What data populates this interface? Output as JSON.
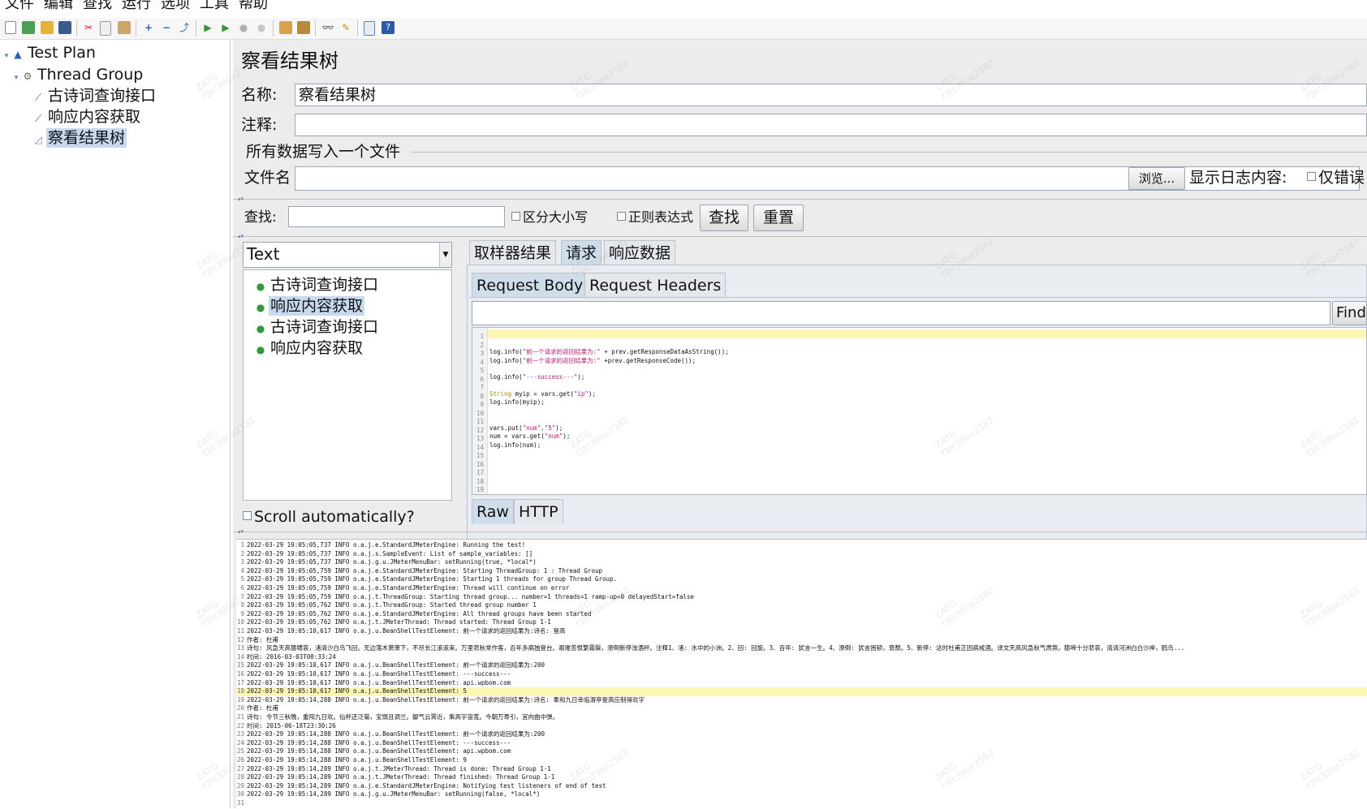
{
  "menu": [
    "文件",
    "编辑",
    "查找",
    "运行",
    "选项",
    "工具",
    "帮助"
  ],
  "tree": {
    "test_plan": "Test Plan",
    "thread_group": "Thread Group",
    "sampler1": "古诗词查询接口",
    "sampler2": "响应内容获取",
    "listener": "察看结果树"
  },
  "panel": {
    "title": "察看结果树",
    "name_label": "名称:",
    "name_value": "察看结果树",
    "comment_label": "注释:",
    "comment_value": "",
    "file_section": "所有数据写入一个文件",
    "filename_label": "文件名",
    "filename_value": "",
    "browse_label": "浏览...",
    "log_display_label": "显示日志内容:",
    "errors_only_label": "仅错误"
  },
  "search": {
    "label": "查找:",
    "value": "",
    "case_label": "区分大小写",
    "regex_label": "正则表达式",
    "find_label": "查找",
    "reset_label": "重置"
  },
  "results": {
    "renderer": "Text",
    "items": [
      "古诗词查询接口",
      "响应内容获取",
      "古诗词查询接口",
      "响应内容获取"
    ],
    "selected_index": 1,
    "scroll_label": "Scroll automatically?"
  },
  "tabs": {
    "main": [
      "取样器结果",
      "请求",
      "响应数据"
    ],
    "main_active": "请求",
    "sub": [
      "Request Body",
      "Request Headers"
    ],
    "sub_active": "Request Body",
    "bottom": [
      "Raw",
      "HTTP"
    ],
    "bottom_active": "Raw"
  },
  "find_button": "Find",
  "code_lines": [
    "1",
    "2",
    "3",
    "4",
    "5",
    "6",
    "7",
    "8",
    "9",
    "10",
    "11",
    "12",
    "13",
    "14",
    "15",
    "16",
    "17",
    "18",
    "19"
  ],
  "code": {
    "l3a": "log.info(",
    "l3s": "\"前一个请求的返回结果为:\"",
    "l3b": " + prev.getResponseDataAsString());",
    "l4a": "log.info(",
    "l4s": "\"前一个请求的返回结果为:\"",
    "l4b": " +prev.getResponseCode());",
    "l6a": "log.info(",
    "l6s": "\"---success---\"",
    "l6b": ");",
    "l8k": "String",
    "l8a": " myip = vars.get(",
    "l8s": "\"ip\"",
    "l8b": ");",
    "l9": "log.info(myip);",
    "l12a": "vars.put(",
    "l12s": "\"num\",\"5\"",
    "l12b": ");",
    "l13a": "num = vars.get(",
    "l13s": "\"num\"",
    "l13b": ");",
    "l14": "log.info(num);"
  },
  "log": [
    "2022-03-29 19:05:05,737 INFO o.a.j.e.StandardJMeterEngine: Running the test!",
    "2022-03-29 19:05:05,737 INFO o.a.j.s.SampleEvent: List of sample_variables: []",
    "2022-03-29 19:05:05,737 INFO o.a.j.g.u.JMeterMenuBar: setRunning(true, *local*)",
    "2022-03-29 19:05:05,759 INFO o.a.j.e.StandardJMeterEngine: Starting ThreadGroup: 1 : Thread Group",
    "2022-03-29 19:05:05,759 INFO o.a.j.e.StandardJMeterEngine: Starting 1 threads for group Thread Group.",
    "2022-03-29 19:05:05,759 INFO o.a.j.e.StandardJMeterEngine: Thread will continue on error",
    "2022-03-29 19:05:05,759 INFO o.a.j.t.ThreadGroup: Starting thread group... number=1 threads=1 ramp-up=0 delayedStart=false",
    "2022-03-29 19:05:05,762 INFO o.a.j.t.ThreadGroup: Started thread group number 1",
    "2022-03-29 19:05:05,762 INFO o.a.j.e.StandardJMeterEngine: All thread groups have been started",
    "2022-03-29 19:05:05,762 INFO o.a.j.t.JMeterThread: Thread started: Thread Group 1-1",
    "2022-03-29 19:05:10,617 INFO o.a.j.u.BeanShellTestElement: 前一个请求的返回结果为:诗名: 登高",
    "作者: 杜甫",
    "诗句: 风急天高猿啸哀，渚清沙白鸟飞回。无边落木萧萧下，不尽长江滚滚来。万里悲秋常作客，百年多病独登台。艰难苦恨繁霜鬓，潦倒新停浊酒杯。注释1、渚: 水中的小洲。2、回: 回旋。3、百年: 犹言一生。4、潦倒: 犹言困顿，衰颓。5、新停: 这时杜甫正因病戒酒。译文天高风急秋气肃煞，猿啼十分悲哀，清清河洲白白沙岸，鸥鸟...",
    "时间: 2016-03-03T00:33:24",
    "2022-03-29 19:05:10,617 INFO o.a.j.u.BeanShellTestElement: 前一个请求的返回结果为:200",
    "2022-03-29 19:05:10,617 INFO o.a.j.u.BeanShellTestElement: ---success---",
    "2022-03-29 19:05:10,617 INFO o.a.j.u.BeanShellTestElement: api.wpbom.com",
    "2022-03-29 19:05:10,617 INFO o.a.j.u.BeanShellTestElement: 5",
    "2022-03-29 19:05:14,288 INFO o.a.j.u.BeanShellTestElement: 前一个请求的返回结果为:诗名: 奉和九日幸临渭亭登高应制得欢字",
    "作者: 杜甫",
    "诗句: 令节三秋晚，重阳九日欢。仙杯还泛菊，宝馔且调兰。御气云霄近，乘高宇宙宽。今朝万寿引，宜向曲中弹。",
    "时间: 2015-06-18T23:30:26",
    "2022-03-29 19:05:14,288 INFO o.a.j.u.BeanShellTestElement: 前一个请求的返回结果为:200",
    "2022-03-29 19:05:14,288 INFO o.a.j.u.BeanShellTestElement: ---success---",
    "2022-03-29 19:05:14,288 INFO o.a.j.u.BeanShellTestElement: api.wpbom.com",
    "2022-03-29 19:05:14,288 INFO o.a.j.u.BeanShellTestElement: 9",
    "2022-03-29 19:05:14,289 INFO o.a.j.t.JMeterThread: Thread is done: Thread Group 1-1",
    "2022-03-29 19:05:14,289 INFO o.a.j.t.JMeterThread: Thread finished: Thread Group 1-1",
    "2022-03-29 19:05:14,289 INFO o.a.j.e.StandardJMeterEngine: Notifying test listeners of end of test",
    "2022-03-29 19:05:14,289 INFO o.a.j.g.u.JMeterMenuBar: setRunning(false, *local*)",
    ""
  ],
  "log_highlight_line": 18,
  "watermark": "ZATG\nf3fc39be2582",
  "colors": {
    "selection": "#c7d9ee",
    "highlight_line": "#fbf7b2",
    "code_string": "#c2187a",
    "code_keyword": "#c28a00",
    "success_icon": "#2e9a3a"
  }
}
